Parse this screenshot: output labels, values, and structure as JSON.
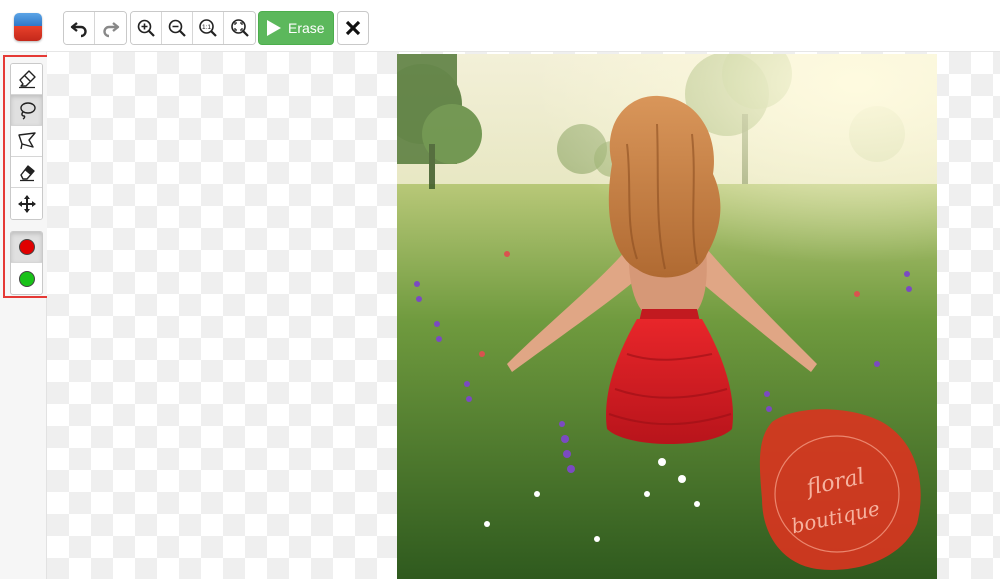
{
  "toolbar": {
    "app_icon": "app-logo-icon",
    "history": [
      {
        "name": "undo-button",
        "icon": "undo-icon"
      },
      {
        "name": "redo-button",
        "icon": "redo-icon"
      }
    ],
    "zoom": [
      {
        "name": "zoom-in-button",
        "icon": "zoom-in-icon"
      },
      {
        "name": "zoom-out-button",
        "icon": "zoom-out-icon"
      },
      {
        "name": "zoom-actual-size-button",
        "icon": "zoom-actual-size-icon",
        "glyph": "1:1"
      },
      {
        "name": "zoom-fit-button",
        "icon": "zoom-fit-icon"
      }
    ],
    "erase_label": "Erase",
    "erase_color": "#5cb85c",
    "close_icon": "close-icon"
  },
  "sidebar": {
    "highlight_color": "#e53935",
    "tools": [
      {
        "name": "marker-tool",
        "icon": "marker-icon",
        "active": false
      },
      {
        "name": "lasso-tool",
        "icon": "lasso-icon",
        "active": true
      },
      {
        "name": "polygon-lasso-tool",
        "icon": "polygon-lasso-icon",
        "active": false
      },
      {
        "name": "eraser-tool",
        "icon": "eraser-icon",
        "active": false
      },
      {
        "name": "move-tool",
        "icon": "move-icon",
        "active": false
      }
    ],
    "colors": [
      {
        "name": "red-marker-color",
        "color": "#e00000",
        "active": true
      },
      {
        "name": "green-marker-color",
        "color": "#19c219",
        "active": false
      }
    ]
  },
  "canvas": {
    "image": "meadow-woman-red-dress-photo",
    "watermark": {
      "line1": "floral",
      "line2": "boutique",
      "color": "#d7351f"
    }
  }
}
